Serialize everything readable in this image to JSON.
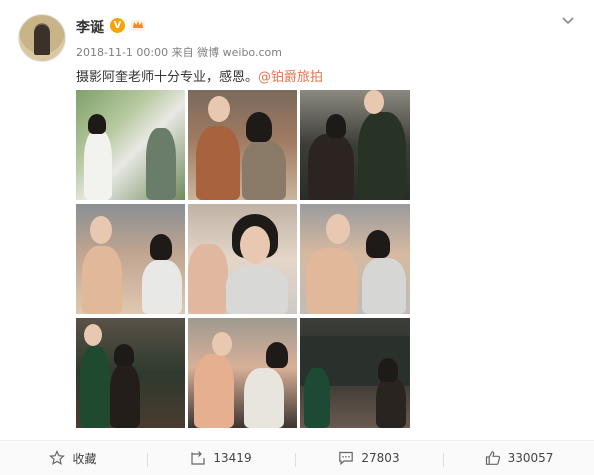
{
  "post": {
    "username": "李诞",
    "verified_badge": "V",
    "timestamp": "2018-11-1 00:00",
    "source": "来自 微博 weibo.com",
    "text": "摄影阿奎老师十分专业，感恩。",
    "mention": "@铂爵旅拍"
  },
  "photos": [
    {
      "name": "photo-1"
    },
    {
      "name": "photo-2"
    },
    {
      "name": "photo-3"
    },
    {
      "name": "photo-4"
    },
    {
      "name": "photo-5"
    },
    {
      "name": "photo-6"
    },
    {
      "name": "photo-7"
    },
    {
      "name": "photo-8"
    },
    {
      "name": "photo-9"
    }
  ],
  "actions": {
    "favorite_label": "收藏",
    "repost_count": "13419",
    "comment_count": "27803",
    "like_count": "330057"
  },
  "colors": {
    "mention": "#eb7350",
    "verified": "#f7a400",
    "meta_text": "#808080"
  }
}
